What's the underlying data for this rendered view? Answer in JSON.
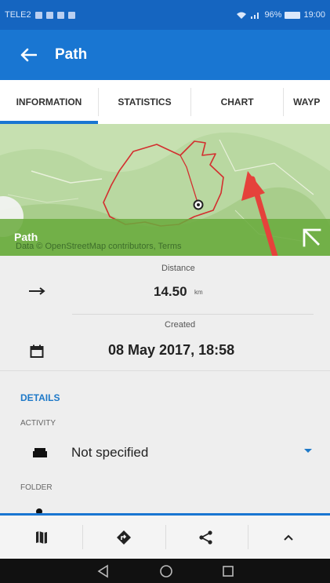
{
  "status_bar": {
    "carrier": "TELE2",
    "battery": "96%",
    "time": "19:00"
  },
  "app_bar": {
    "title": "Path",
    "back_icon": "arrow-left-icon"
  },
  "tabs": [
    {
      "label": "INFORMATION",
      "active": true
    },
    {
      "label": "STATISTICS",
      "active": false
    },
    {
      "label": "CHART",
      "active": false
    },
    {
      "label": "WAYP",
      "active": false
    }
  ],
  "map": {
    "overlay_label": "Path",
    "attribution": "Data © OpenStreetMap contributors, Terms",
    "expand_icon": "expand-arrow-icon"
  },
  "stats": {
    "distance_label": "Distance",
    "distance_value": "14.50",
    "distance_unit": "km",
    "created_label": "Created",
    "created_value": "08 May 2017, 18:58",
    "distance_icon": "arrow-right-icon",
    "calendar_icon": "calendar-icon"
  },
  "details": {
    "header": "DETAILS",
    "activity_label": "ACTIVITY",
    "activity_value": "Not specified",
    "folder_label": "FOLDER",
    "activity_icon": "sofa-icon"
  },
  "bottom_actions": [
    {
      "icon": "map-icon"
    },
    {
      "icon": "navigate-icon"
    },
    {
      "icon": "share-icon"
    },
    {
      "icon": "chevron-up-icon"
    }
  ],
  "colors": {
    "primary": "#1976d2",
    "status": "#1565c0",
    "accent": "#1e79c8",
    "route": "#d32f2f",
    "map_green": "#69aa3c"
  }
}
